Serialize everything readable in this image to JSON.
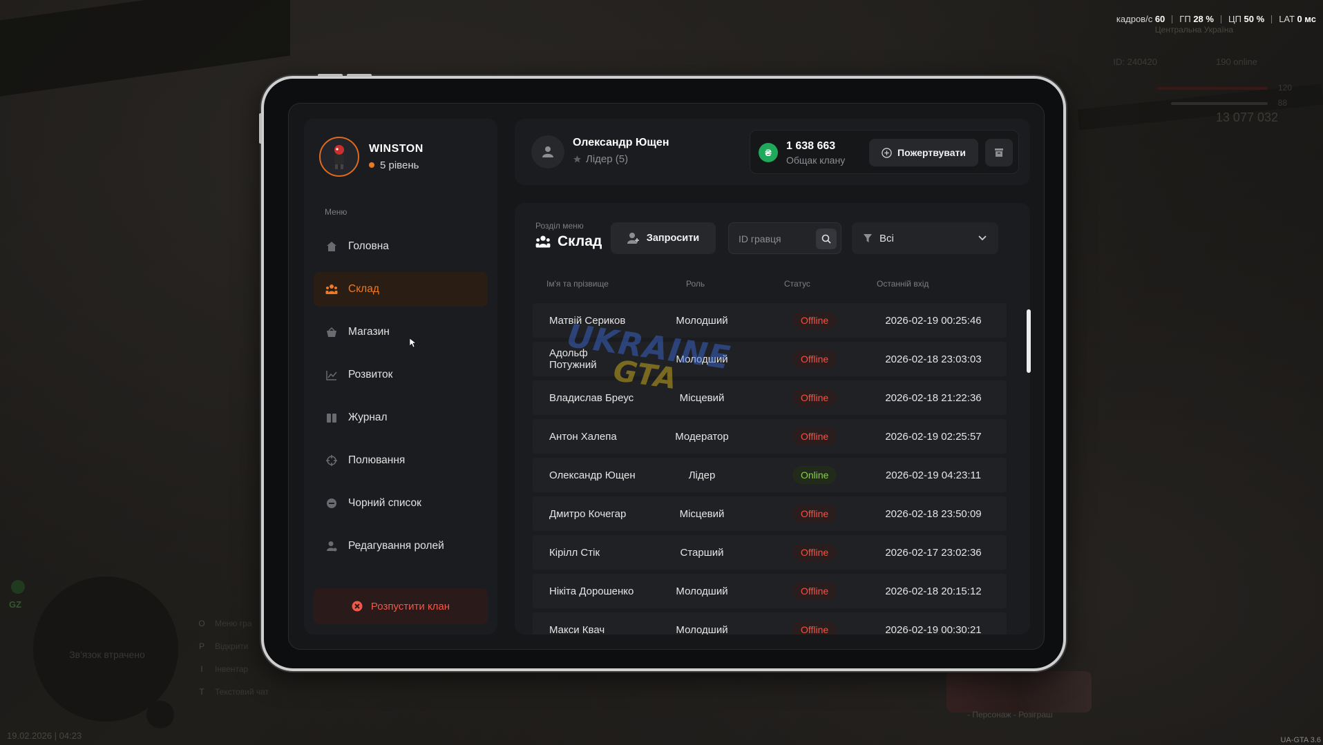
{
  "hud": {
    "fps_label": "кадров/с",
    "fps_value": "60",
    "gpu_label": "ГП",
    "gpu_value": "28 %",
    "cpu_label": "ЦП",
    "cpu_value": "50 %",
    "lat_label": "LAT",
    "lat_value": "0 мс",
    "region": "Центральна Україна",
    "player_id": "ID: 240420",
    "online": "190 online",
    "health": "120",
    "armor": "88",
    "money": "13 077 032",
    "gz": "GZ",
    "minimap_status": "Зв'язок втрачено",
    "hints": [
      {
        "key": "O",
        "label": "Меню гра"
      },
      {
        "key": "P",
        "label": "Відкрити"
      },
      {
        "key": "I",
        "label": "Інвентар"
      },
      {
        "key": "T",
        "label": "Текстовий чат"
      }
    ],
    "datetime": "19.02.2026 | 04:23",
    "version": "UA-GTA 3.6",
    "giveaway_text": "- Персонаж - Розіграш"
  },
  "watermark": {
    "line1": "UKRAINE",
    "line2": "GTA"
  },
  "profile": {
    "name": "WINSTON",
    "level": "5 рівень"
  },
  "menu": {
    "title": "Меню",
    "items": [
      {
        "label": "Головна",
        "icon": "home-icon",
        "active": false
      },
      {
        "label": "Склад",
        "icon": "people-icon",
        "active": true
      },
      {
        "label": "Магазин",
        "icon": "basket-icon",
        "active": false
      },
      {
        "label": "Розвиток",
        "icon": "chart-icon",
        "active": false
      },
      {
        "label": "Журнал",
        "icon": "book-icon",
        "active": false
      },
      {
        "label": "Полювання",
        "icon": "crosshair-icon",
        "active": false
      },
      {
        "label": "Чорний список",
        "icon": "block-icon",
        "active": false
      },
      {
        "label": "Редагування ролей",
        "icon": "user-edit-icon",
        "active": false
      }
    ],
    "disband_label": "Розпустити клан"
  },
  "user": {
    "name": "Олександр Ющен",
    "role": "Лідер (5)"
  },
  "balance": {
    "amount": "1 638 663",
    "label": "Общак клану",
    "currency_symbol": "₴",
    "donate_label": "Пожертвувати"
  },
  "section": {
    "label": "Розділ меню",
    "title": "Склад",
    "invite_label": "Запросити",
    "search_placeholder": "ID гравця",
    "filter_value": "Всі"
  },
  "table": {
    "headers": {
      "name": "Ім'я та прізвище",
      "role": "Роль",
      "status": "Статус",
      "last": "Останній вхід"
    },
    "rows": [
      {
        "name": "Матвій Сериков",
        "role": "Молодший",
        "status": "Offline",
        "last": "2026-02-19 00:25:46"
      },
      {
        "name": "Адольф Потужний",
        "role": "Молодший",
        "status": "Offline",
        "last": "2026-02-18 23:03:03"
      },
      {
        "name": "Владислав Бреус",
        "role": "Місцевий",
        "status": "Offline",
        "last": "2026-02-18 21:22:36"
      },
      {
        "name": "Антон Халепа",
        "role": "Модератор",
        "status": "Offline",
        "last": "2026-02-19 02:25:57"
      },
      {
        "name": "Олександр Ющен",
        "role": "Лідер",
        "status": "Online",
        "last": "2026-02-19 04:23:11"
      },
      {
        "name": "Дмитро Кочегар",
        "role": "Місцевий",
        "status": "Offline",
        "last": "2026-02-18 23:50:09"
      },
      {
        "name": "Кірілл Стік",
        "role": "Старший",
        "status": "Offline",
        "last": "2026-02-17 23:02:36"
      },
      {
        "name": "Нікіта Дорошенко",
        "role": "Молодший",
        "status": "Offline",
        "last": "2026-02-18 20:15:12"
      },
      {
        "name": "Макси Квач",
        "role": "Молодший",
        "status": "Offline",
        "last": "2026-02-19 00:30:21"
      }
    ]
  },
  "colors": {
    "accent": "#f07a26",
    "offline": "#f05448",
    "online": "#8ad04a",
    "coin": "#1fa95a"
  }
}
